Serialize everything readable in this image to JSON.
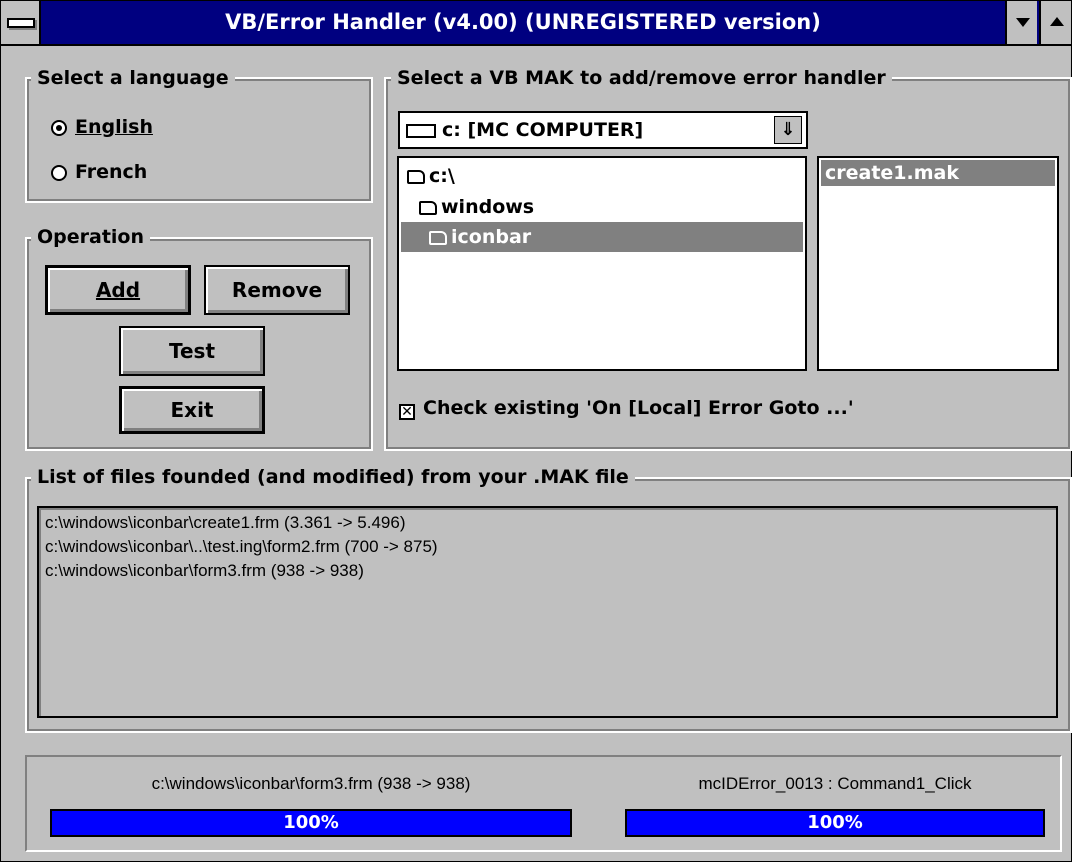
{
  "window": {
    "title": "VB/Error Handler (v4.00) (UNREGISTERED version)"
  },
  "language": {
    "legend": "Select a language",
    "options": [
      {
        "label": "English",
        "selected": true
      },
      {
        "label": "French",
        "selected": false
      }
    ]
  },
  "operation": {
    "legend": "Operation",
    "add_label": "Add",
    "remove_label": "Remove",
    "test_label": "Test",
    "exit_label": "Exit"
  },
  "mak": {
    "legend": "Select a VB MAK to add/remove error handler",
    "drive": "c: [MC COMPUTER]",
    "dirs": [
      "c:\\",
      "windows",
      "iconbar"
    ],
    "selected_dir": "iconbar",
    "files": [
      "create1.mak"
    ],
    "check_label": "Check existing 'On [Local] Error Goto ...'",
    "check_checked": true
  },
  "files_found": {
    "legend": "List of files founded (and modified) from your .MAK file",
    "lines": [
      "c:\\windows\\iconbar\\create1.frm (3.361 -> 5.496)",
      "c:\\windows\\iconbar\\..\\test.ing\\form2.frm (700 -> 875)",
      "c:\\windows\\iconbar\\form3.frm (938 -> 938)"
    ]
  },
  "status": {
    "left_text": "c:\\windows\\iconbar\\form3.frm (938 -> 938)",
    "right_text": "mcIDError_0013 : Command1_Click",
    "left_progress": 1.0,
    "right_progress": 1.0,
    "left_label": "100%",
    "right_label": "100%",
    "bar_color": "#0000ff"
  }
}
